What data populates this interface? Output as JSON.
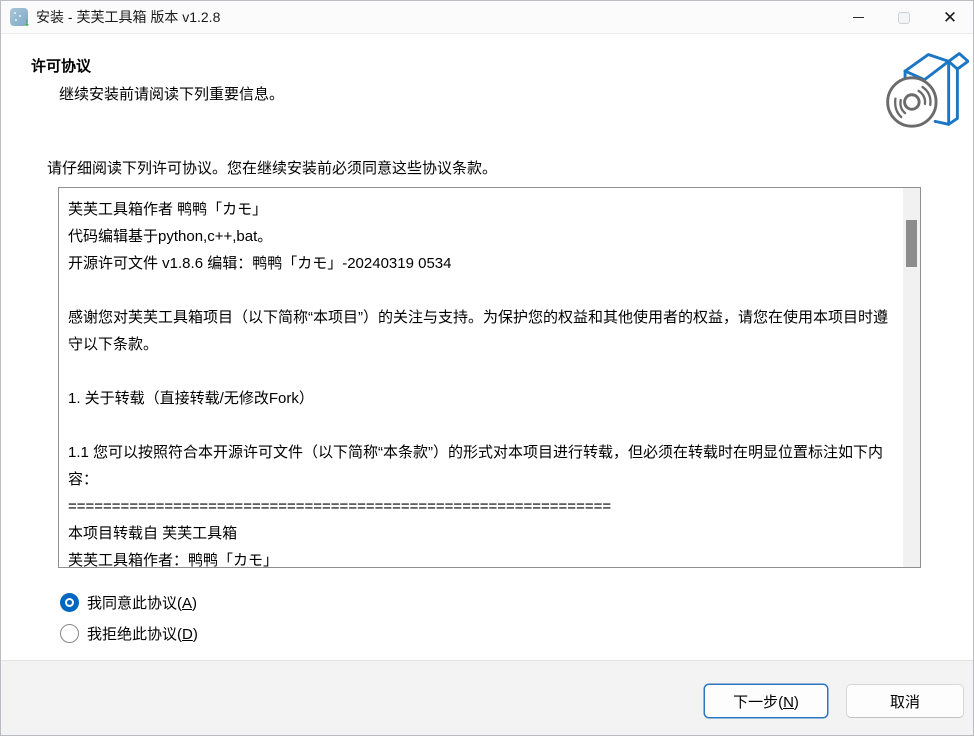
{
  "titlebar": {
    "title": "安装 - 芙芙工具箱 版本 v1.2.8",
    "icons": {
      "close_glyph": "✕",
      "app_arrow_glyph": "⭣"
    }
  },
  "header": {
    "title": "许可协议",
    "subtitle": "继续安装前请阅读下列重要信息。"
  },
  "content": {
    "instruction": "请仔细阅读下列许可协议。您在继续安装前必须同意这些协议条款。",
    "license_text": "芙芙工具箱作者 鸭鸭「カモ」\n代码编辑基于python,c++,bat。\n开源许可文件 v1.8.6 编辑：鸭鸭「カモ」-20240319 0534\n\n感谢您对芙芙工具箱项目（以下简称“本项目”）的关注与支持。为保护您的权益和其他使用者的权益，请您在使用本项目时遵守以下条款。\n\n1. 关于转载（直接转载/无修改Fork）\n\n1.1 您可以按照符合本开源许可文件（以下简称“本条款”）的形式对本项目进行转载，但必须在转载时在明显位置标注如下内容：\n==============================================================\n本项目转载自 芙芙工具箱\n芙芙工具箱作者：鸭鸭「カモ」",
    "radios": {
      "accept": {
        "prefix": "我同意此协议(",
        "mnemonic": "A",
        "suffix": ")",
        "selected": true
      },
      "decline": {
        "prefix": "我拒绝此协议(",
        "mnemonic": "D",
        "suffix": ")",
        "selected": false
      }
    }
  },
  "footer": {
    "next": {
      "prefix": "下一步(",
      "mnemonic": "N",
      "suffix": ")"
    },
    "cancel_label": "取消"
  },
  "colors": {
    "accent": "#0067c0",
    "next_button_border": "#2c77bd",
    "titlebar_bg": "#fbfbfb",
    "footer_bg": "#f3f3f3",
    "license_box_border": "#8f8f8f",
    "scroll_thumb": "#8c8c8c",
    "wizard_box_blue": "#1b76c4",
    "wizard_disc_gray": "#6b6b6b"
  }
}
